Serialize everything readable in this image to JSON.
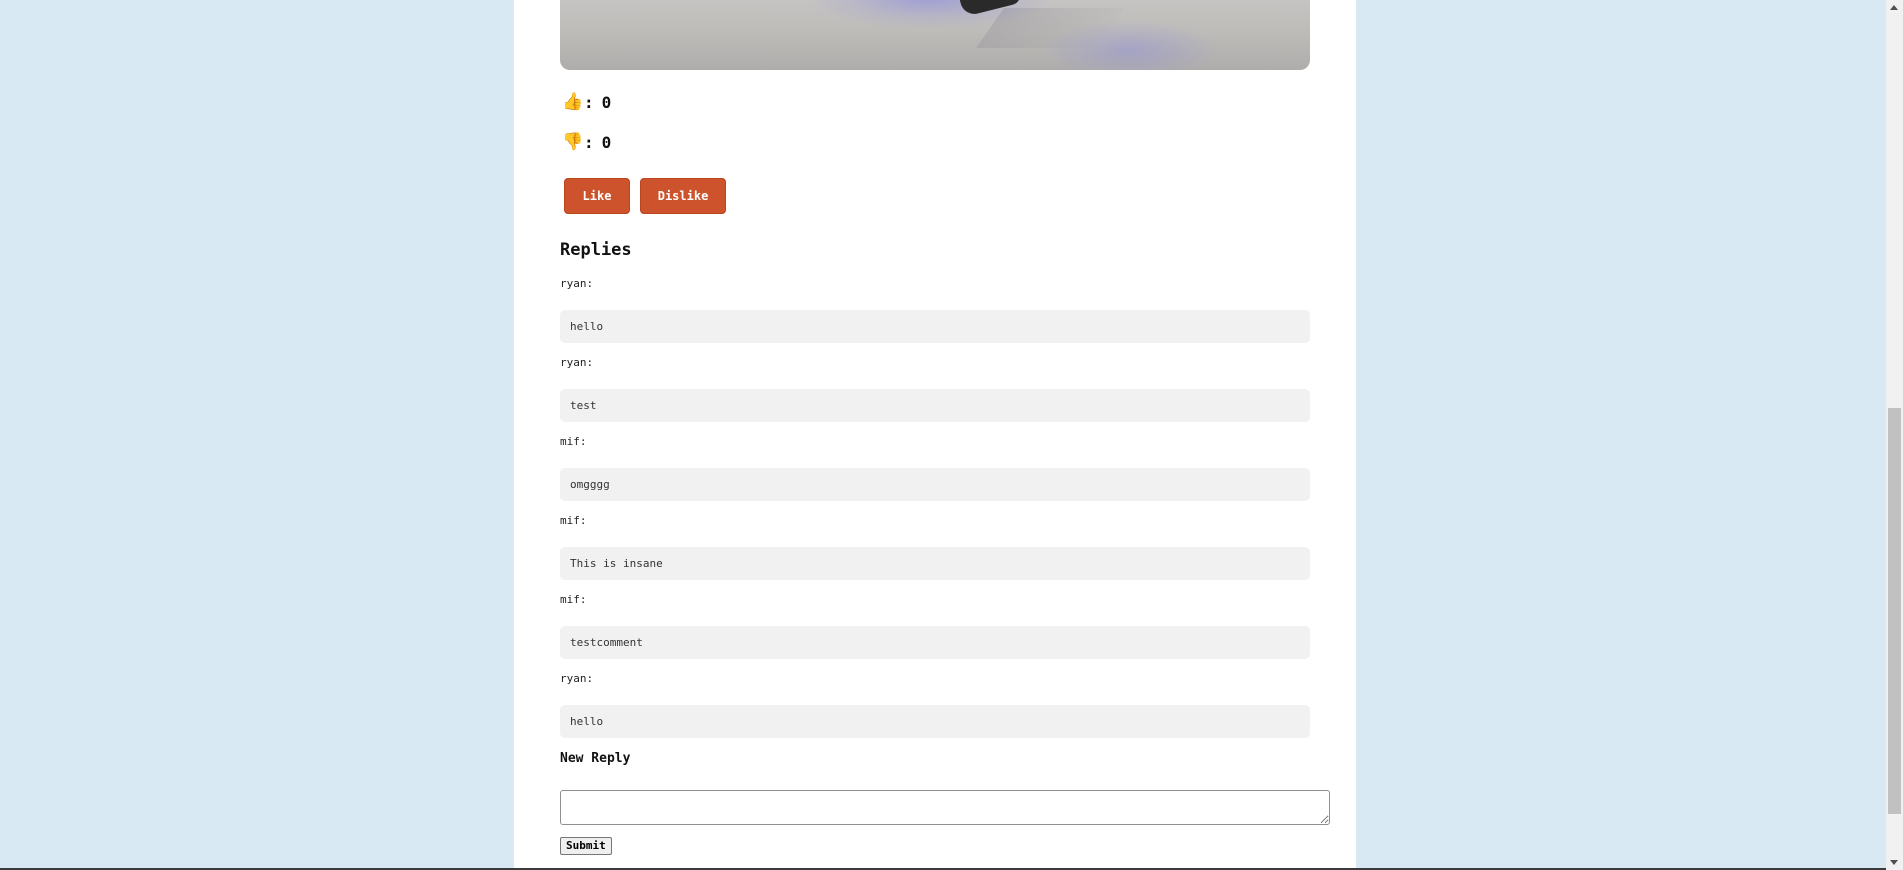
{
  "reactions": {
    "like_icon": "thumbs-up",
    "like_emoji": "👍",
    "like_separator": ":",
    "like_count": "0",
    "dislike_icon": "thumbs-down",
    "dislike_emoji": "👎",
    "dislike_separator": ":",
    "dislike_count": "0"
  },
  "buttons": {
    "like_label": "Like",
    "dislike_label": "Dislike",
    "accent_color": "#cc532c"
  },
  "replies": {
    "heading": "Replies",
    "items": [
      {
        "author": "ryan:",
        "text": "hello"
      },
      {
        "author": "ryan:",
        "text": "test"
      },
      {
        "author": "mif:",
        "text": "omgggg"
      },
      {
        "author": "mif:",
        "text": "This is insane"
      },
      {
        "author": "mif:",
        "text": "testcomment"
      },
      {
        "author": "ryan:",
        "text": "hello"
      }
    ]
  },
  "new_reply": {
    "heading": "New Reply",
    "textarea_value": "",
    "submit_label": "Submit"
  },
  "colors": {
    "page_background": "#d9e9f3",
    "content_background": "#ffffff",
    "reply_background": "#f1f1f1"
  }
}
